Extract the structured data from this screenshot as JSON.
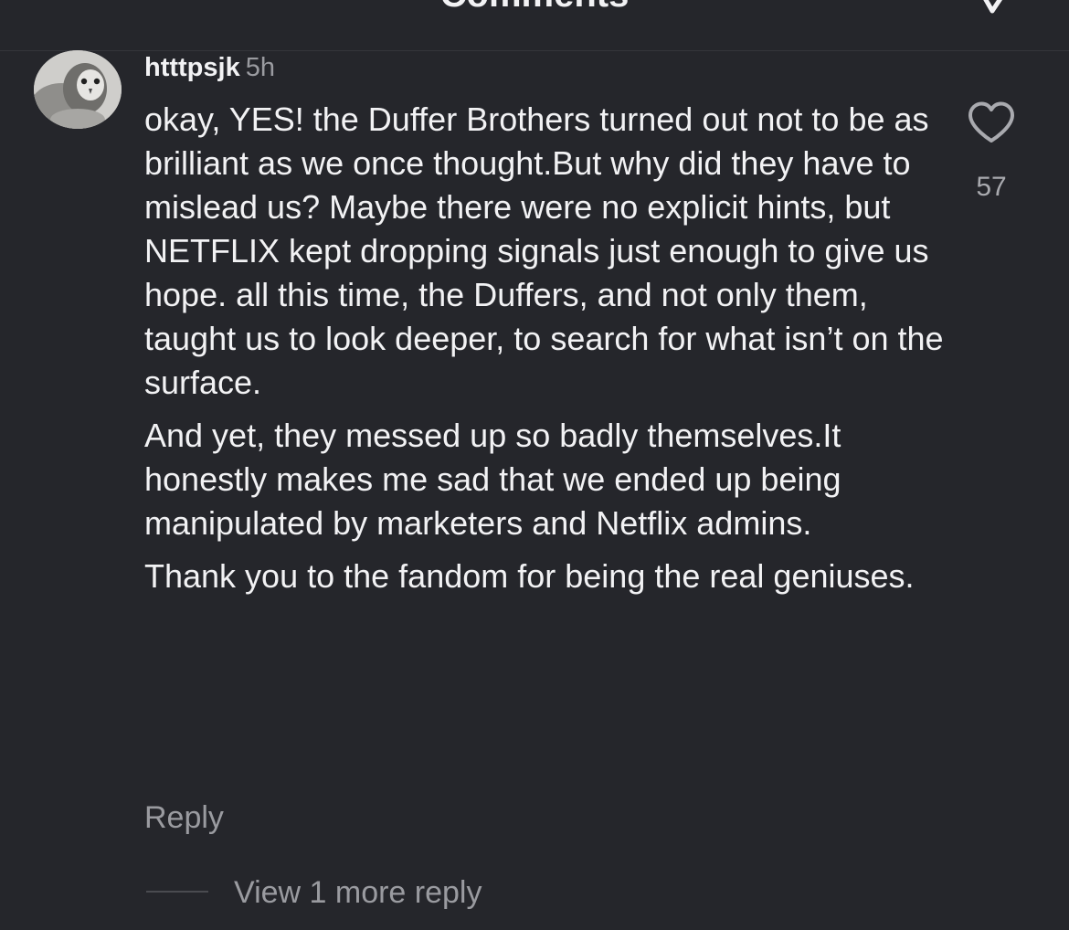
{
  "header": {
    "title": "Comments"
  },
  "comment": {
    "username": "htttpsjk",
    "timestamp": "5h",
    "paragraphs": [
      "okay, YES! the Duffer Brothers turned out not to be as brilliant as we once thought.But why did they have to mislead us? Maybe there were no explicit hints, but NETFLIX kept dropping signals just enough to give us hope. all this time, the Duffers, and not only them, taught us to look deeper, to search for what isn’t on the surface.",
      "And yet, they messed up so badly themselves.It honestly makes me sad that we ended up being manipulated by marketers and Netflix admins.",
      "Thank you to the fandom for being the real geniuses."
    ],
    "likes": "57",
    "reply_label": "Reply",
    "view_more_label": "View 1 more reply"
  },
  "icons": {
    "avatar": "owl-avatar",
    "like": "heart-outline-icon",
    "header_action": "check-icon"
  },
  "colors": {
    "background": "#25262b",
    "text_primary": "#f2f2f4",
    "text_secondary": "#9a9ba0"
  }
}
